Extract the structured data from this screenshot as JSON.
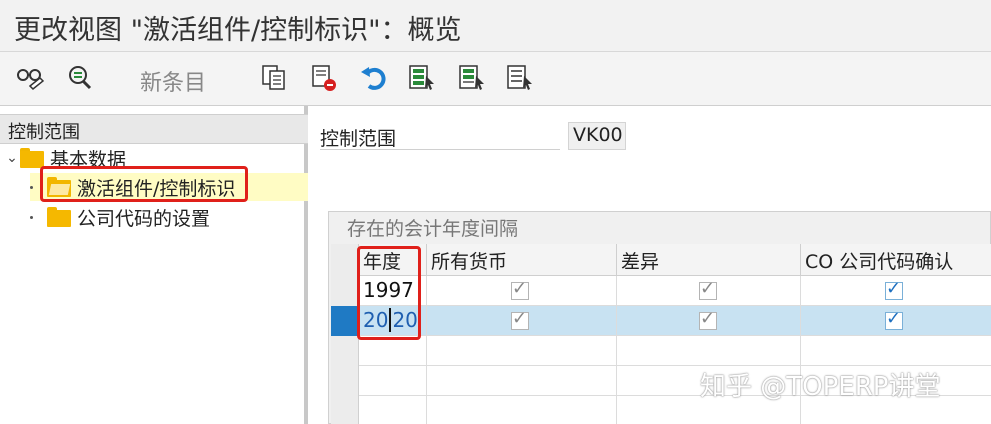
{
  "window": {
    "title": "更改视图 \"激活组件/控制标识\"：概览"
  },
  "toolbar": {
    "new_entries_label": "新条目",
    "icons": [
      "glasses-edit-icon",
      "find-icon",
      "copy-as-icon",
      "delete-icon",
      "undo-icon",
      "select-all-icon",
      "select-block-icon",
      "deselect-all-icon"
    ]
  },
  "navigation": {
    "header": "控制范围",
    "tree": [
      {
        "label": "基本数据",
        "expanded": true
      },
      {
        "label": "激活组件/控制标识",
        "selected": true
      },
      {
        "label": "公司代码的设置"
      }
    ]
  },
  "form": {
    "label": "控制范围",
    "value": "VK00"
  },
  "table": {
    "title": "存在的会计年度间隔",
    "columns": [
      "年度",
      "所有货币",
      "差异",
      "CO 公司代码确认"
    ],
    "rows": [
      {
        "year": "1997",
        "all_currencies": true,
        "variances": true,
        "co_confirm": true
      },
      {
        "year_part1": "20",
        "year_part2": "20",
        "all_currencies": true,
        "variances": true,
        "co_confirm": true,
        "selected": true
      }
    ]
  },
  "watermark": "知乎 @TOPERP讲堂",
  "colors": {
    "accent": "#1f7ac4",
    "highlight_row": "#c8e2f2",
    "annotation_red": "#e0201a",
    "selected_tree": "#fffcc4"
  }
}
